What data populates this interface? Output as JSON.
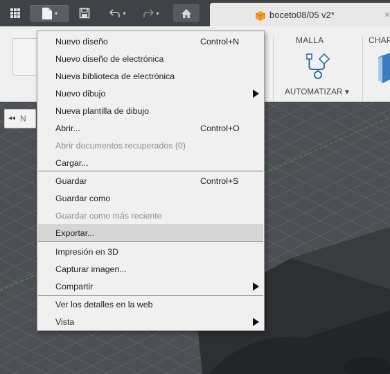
{
  "topbar": {
    "icons": [
      "grid-icon",
      "file-icon",
      "save-icon",
      "undo-icon",
      "redo-icon",
      "home-icon",
      "cube-icon",
      "close-icon"
    ],
    "dropdown_caret": "▾"
  },
  "document_tab": {
    "title": "boceto08/05 v2*",
    "close": "×"
  },
  "ribbon": {
    "groups": [
      {
        "label": "MALLA"
      },
      {
        "label": "CHAP"
      }
    ],
    "automatizar_label": "AUTOMATIZAR ▾"
  },
  "browser_panel": {
    "collapse_arrow": "◂◂",
    "label_fragment": "N"
  },
  "file_menu": {
    "groups": [
      {
        "items": [
          {
            "label": "Nuevo diseño",
            "shortcut": "Control+N",
            "submenu": false,
            "disabled": false,
            "highlighted": false
          },
          {
            "label": "Nuevo diseño de electrónica",
            "shortcut": "",
            "submenu": false,
            "disabled": false,
            "highlighted": false
          },
          {
            "label": "Nueva biblioteca de electrónica",
            "shortcut": "",
            "submenu": false,
            "disabled": false,
            "highlighted": false
          },
          {
            "label": "Nuevo dibujo",
            "shortcut": "",
            "submenu": true,
            "disabled": false,
            "highlighted": false
          },
          {
            "label": "Nueva plantilla de dibujo",
            "shortcut": "",
            "submenu": false,
            "disabled": false,
            "highlighted": false
          },
          {
            "label": "Abrir...",
            "shortcut": "Control+O",
            "submenu": false,
            "disabled": false,
            "highlighted": false
          },
          {
            "label": "Abrir documentos recuperados (0)",
            "shortcut": "",
            "submenu": false,
            "disabled": true,
            "highlighted": false
          },
          {
            "label": "Cargar...",
            "shortcut": "",
            "submenu": false,
            "disabled": false,
            "highlighted": false
          }
        ]
      },
      {
        "items": [
          {
            "label": "Guardar",
            "shortcut": "Control+S",
            "submenu": false,
            "disabled": false,
            "highlighted": false
          },
          {
            "label": "Guardar como",
            "shortcut": "",
            "submenu": false,
            "disabled": false,
            "highlighted": false
          },
          {
            "label": "Guardar como más reciente",
            "shortcut": "",
            "submenu": false,
            "disabled": true,
            "highlighted": false
          },
          {
            "label": "Exportar...",
            "shortcut": "",
            "submenu": false,
            "disabled": false,
            "highlighted": true
          }
        ]
      },
      {
        "items": [
          {
            "label": "Impresión en 3D",
            "shortcut": "",
            "submenu": false,
            "disabled": false,
            "highlighted": false
          },
          {
            "label": "Capturar imagen...",
            "shortcut": "",
            "submenu": false,
            "disabled": false,
            "highlighted": false
          },
          {
            "label": "Compartir",
            "shortcut": "",
            "submenu": true,
            "disabled": false,
            "highlighted": false
          }
        ]
      },
      {
        "items": [
          {
            "label": "Ver los detalles en la web",
            "shortcut": "",
            "submenu": false,
            "disabled": false,
            "highlighted": false
          },
          {
            "label": "Vista",
            "shortcut": "",
            "submenu": true,
            "disabled": false,
            "highlighted": false
          }
        ]
      }
    ]
  },
  "colors": {
    "topbar_bg": "#3f4246",
    "ribbon_bg": "#f0f0f0",
    "menu_bg": "#f0f0f0",
    "menu_highlight": "#d6d6d6",
    "disabled_text": "#8c8c8c",
    "accent_orange": "#f39c2b",
    "ribbon_icon_blue": "#2f6aa8"
  }
}
